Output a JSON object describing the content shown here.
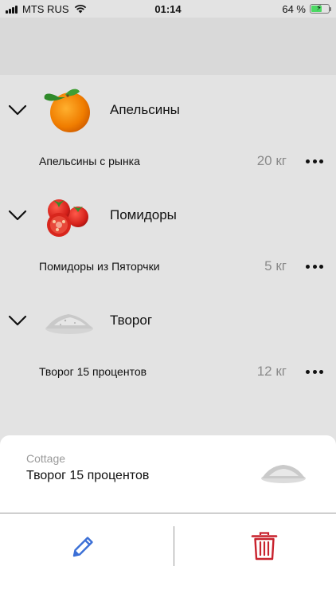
{
  "status_bar": {
    "carrier": "MTS RUS",
    "time": "01:14",
    "battery_percent": "64 %",
    "battery_level": 0.64
  },
  "groups": [
    {
      "title": "Апельсины",
      "icon": "orange-image",
      "items": [
        {
          "name": "Апельсины с рынка",
          "quantity": "20 кг"
        }
      ]
    },
    {
      "title": "Помидоры",
      "icon": "tomato-image",
      "items": [
        {
          "name": "Помидоры из Пяторчки",
          "quantity": "5 кг"
        }
      ]
    },
    {
      "title": "Творог",
      "icon": "cottage-cheese-image",
      "items": [
        {
          "name": "Творог 15 процентов",
          "quantity": "12 кг"
        }
      ]
    }
  ],
  "sheet": {
    "category": "Cottage",
    "product_name": "Творог 15 процентов",
    "edit_icon": "pencil-icon",
    "delete_icon": "trash-icon"
  },
  "colors": {
    "background": "#e3e3e3",
    "edit_blue": "#3b6fd6",
    "delete_red": "#c8222d",
    "quantity_gray": "#8a8a8a"
  }
}
